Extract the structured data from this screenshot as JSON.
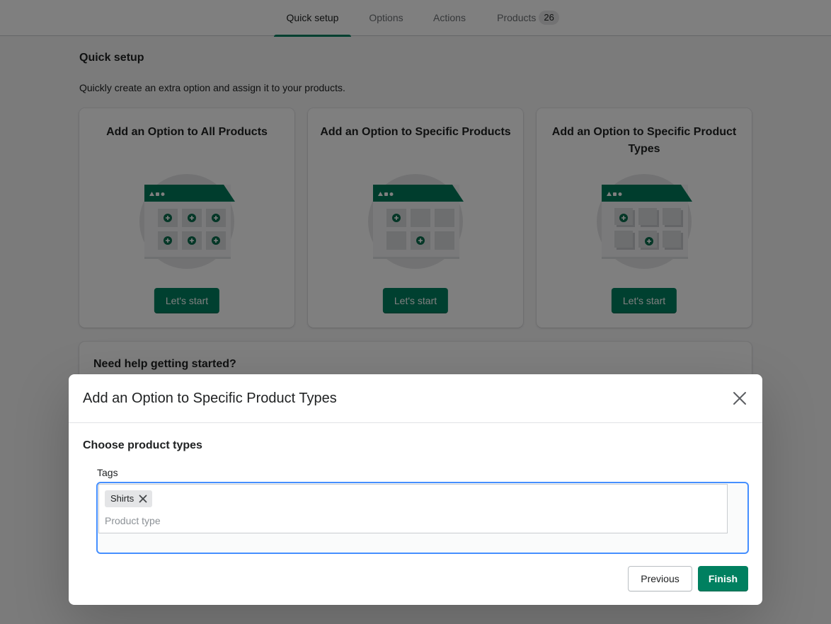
{
  "tabs": [
    {
      "label": "Quick setup"
    },
    {
      "label": "Options"
    },
    {
      "label": "Actions"
    },
    {
      "label": "Products",
      "count": "26"
    }
  ],
  "page": {
    "title": "Quick setup",
    "description": "Quickly create an extra option and assign it to your products."
  },
  "cards": [
    {
      "title": "Add an Option to All Products",
      "button": "Let's start"
    },
    {
      "title": "Add an Option to Specific Products",
      "button": "Let's start"
    },
    {
      "title": "Add an Option to Specific Product Types",
      "button": "Let's start"
    }
  ],
  "help": {
    "title": "Need help getting started?"
  },
  "modal": {
    "title": "Add an Option to Specific Product Types",
    "subtitle": "Choose product types",
    "field_label": "Tags",
    "tags": [
      "Shirts"
    ],
    "input_placeholder": "Product type",
    "input_value": "",
    "previous_label": "Previous",
    "finish_label": "Finish"
  },
  "icons": {
    "close": "close-icon",
    "chip_remove": "close-small-icon",
    "plus": "plus-circle-icon"
  },
  "colors": {
    "brand": "#008060",
    "focus": "#458fff",
    "illustration_circle": "#e4e5e7"
  }
}
